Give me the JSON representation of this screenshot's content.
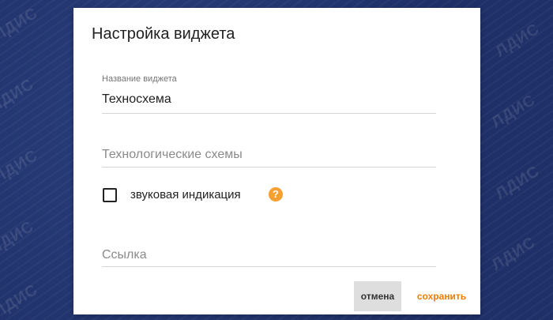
{
  "background": {
    "watermark_text": "ЛДИС",
    "color": "#22356f"
  },
  "dialog": {
    "title": "Настройка виджета",
    "name_field": {
      "label": "Название виджета",
      "value": "Техносхема"
    },
    "scheme_field": {
      "placeholder": "Технологические схемы"
    },
    "sound_indication": {
      "label": "звуковая индикация",
      "checked": false
    },
    "help_icon": {
      "name": "help-icon",
      "glyph": "?",
      "color": "#f5a030"
    },
    "link_field": {
      "placeholder": "Ссылка"
    },
    "buttons": {
      "cancel_label": "отмена",
      "save_label": "сохранить",
      "accent_color": "#f07c00"
    }
  }
}
